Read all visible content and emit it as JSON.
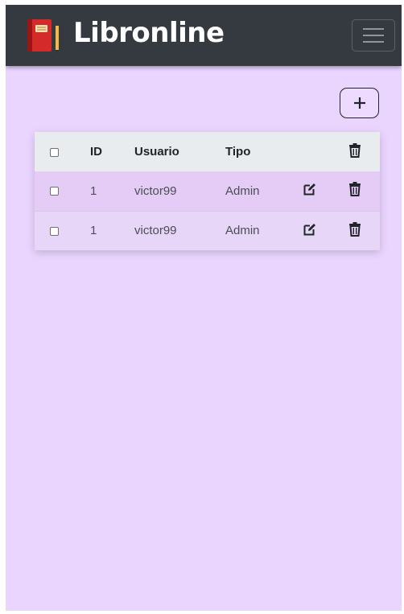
{
  "navbar": {
    "brand": "Libronline",
    "brand_icon": "book-icon",
    "menu_icon": "hamburger-menu-icon"
  },
  "toolbar": {
    "add_icon": "plus-icon"
  },
  "table": {
    "columns": [
      "ID",
      "Usuario",
      "Tipo"
    ],
    "header_delete_icon": "trash-icon",
    "rows": [
      {
        "id": "1",
        "usuario": "victor99",
        "tipo": "Admin"
      },
      {
        "id": "1",
        "usuario": "victor99",
        "tipo": "Admin"
      }
    ],
    "row_edit_icon": "edit-icon",
    "row_delete_icon": "trash-icon"
  },
  "colors": {
    "navbar_bg": "#343a40",
    "page_bg": "#ead5ff",
    "header_bg": "#e9ecef",
    "row_bg": "#e5ccf6"
  }
}
